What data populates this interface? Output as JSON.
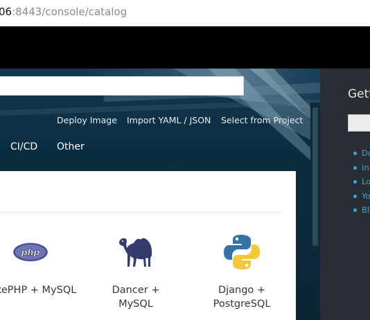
{
  "browser": {
    "url_host": "06",
    "url_rest": ":8443/console/catalog"
  },
  "hero": {
    "search": {
      "placeholder": "",
      "value": ""
    },
    "actions": [
      "Deploy Image",
      "Import YAML / JSON",
      "Select from Project"
    ],
    "category_tabs": [
      "CI/CD",
      "Other"
    ]
  },
  "catalog": {
    "tiles": [
      {
        "title_lines": [
          "kePHP + MySQL"
        ],
        "icon": "php-icon"
      },
      {
        "title_lines": [
          "Dancer + MySQL"
        ],
        "icon": "camel-icon"
      },
      {
        "title_lines": [
          "Django +",
          "PostgreSQL"
        ],
        "icon": "python-icon"
      }
    ]
  },
  "right_panel": {
    "title": "Gett",
    "links": [
      "Do",
      "In",
      "Lo",
      "Yo",
      "Bl"
    ]
  },
  "colors": {
    "hero_bg": "#0c2c40",
    "link": "#39a5dc",
    "right_panel_bg": "#292e34",
    "top_nav": "#000000"
  }
}
